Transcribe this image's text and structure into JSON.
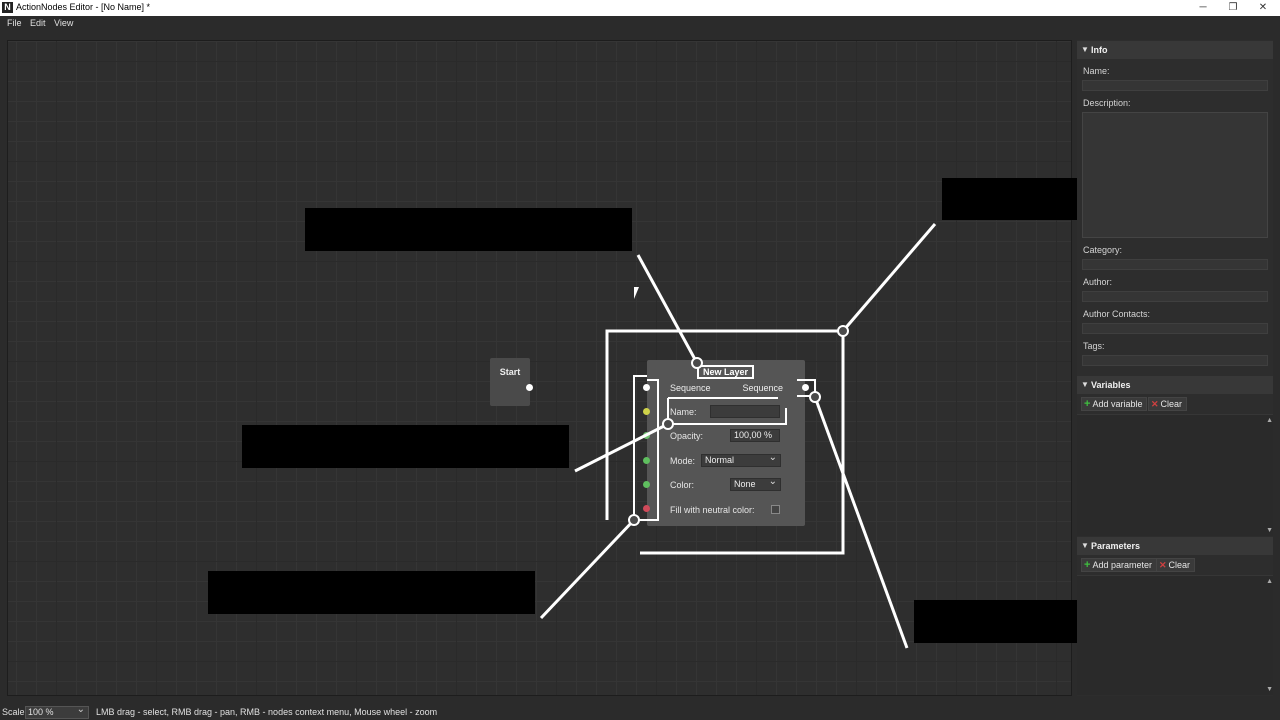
{
  "window": {
    "title": "ActionNodes Editor - [No Name] *",
    "app_icon": "N",
    "controls": [
      "─",
      "❐",
      "✕"
    ]
  },
  "menu": [
    "File",
    "Edit",
    "View"
  ],
  "canvas": {
    "start_node": {
      "label": "Start"
    },
    "layer_node": {
      "title": "New Layer",
      "seq_in": "Sequence",
      "seq_out": "Sequence",
      "name_label": "Name:",
      "name_value": "",
      "opacity_label": "Opacity:",
      "opacity_value": "100,00 %",
      "mode_label": "Mode:",
      "mode_value": "Normal",
      "color_label": "Color:",
      "color_value": "None",
      "fill_label": "Fill with neutral color:",
      "fill_checked": false,
      "port_colors": [
        "#ffffff",
        "#cfd34a",
        "#6fbf6f",
        "#5fbf5f",
        "#5fbf5f",
        "#d04a5a"
      ]
    }
  },
  "panel": {
    "info": {
      "header": "Info",
      "name_label": "Name:",
      "description_label": "Description:",
      "category_label": "Category:",
      "author_label": "Author:",
      "author_contacts_label": "Author Contacts:",
      "tags_label": "Tags:"
    },
    "variables": {
      "header": "Variables",
      "add_label": "Add variable",
      "clear_label": "Clear"
    },
    "parameters": {
      "header": "Parameters",
      "add_label": "Add parameter",
      "clear_label": "Clear"
    }
  },
  "status": {
    "scale_label": "Scale:",
    "scale_value": "100 %",
    "hint": "LMB drag - select, RMB drag - pan, RMB - nodes context menu, Mouse wheel - zoom"
  }
}
